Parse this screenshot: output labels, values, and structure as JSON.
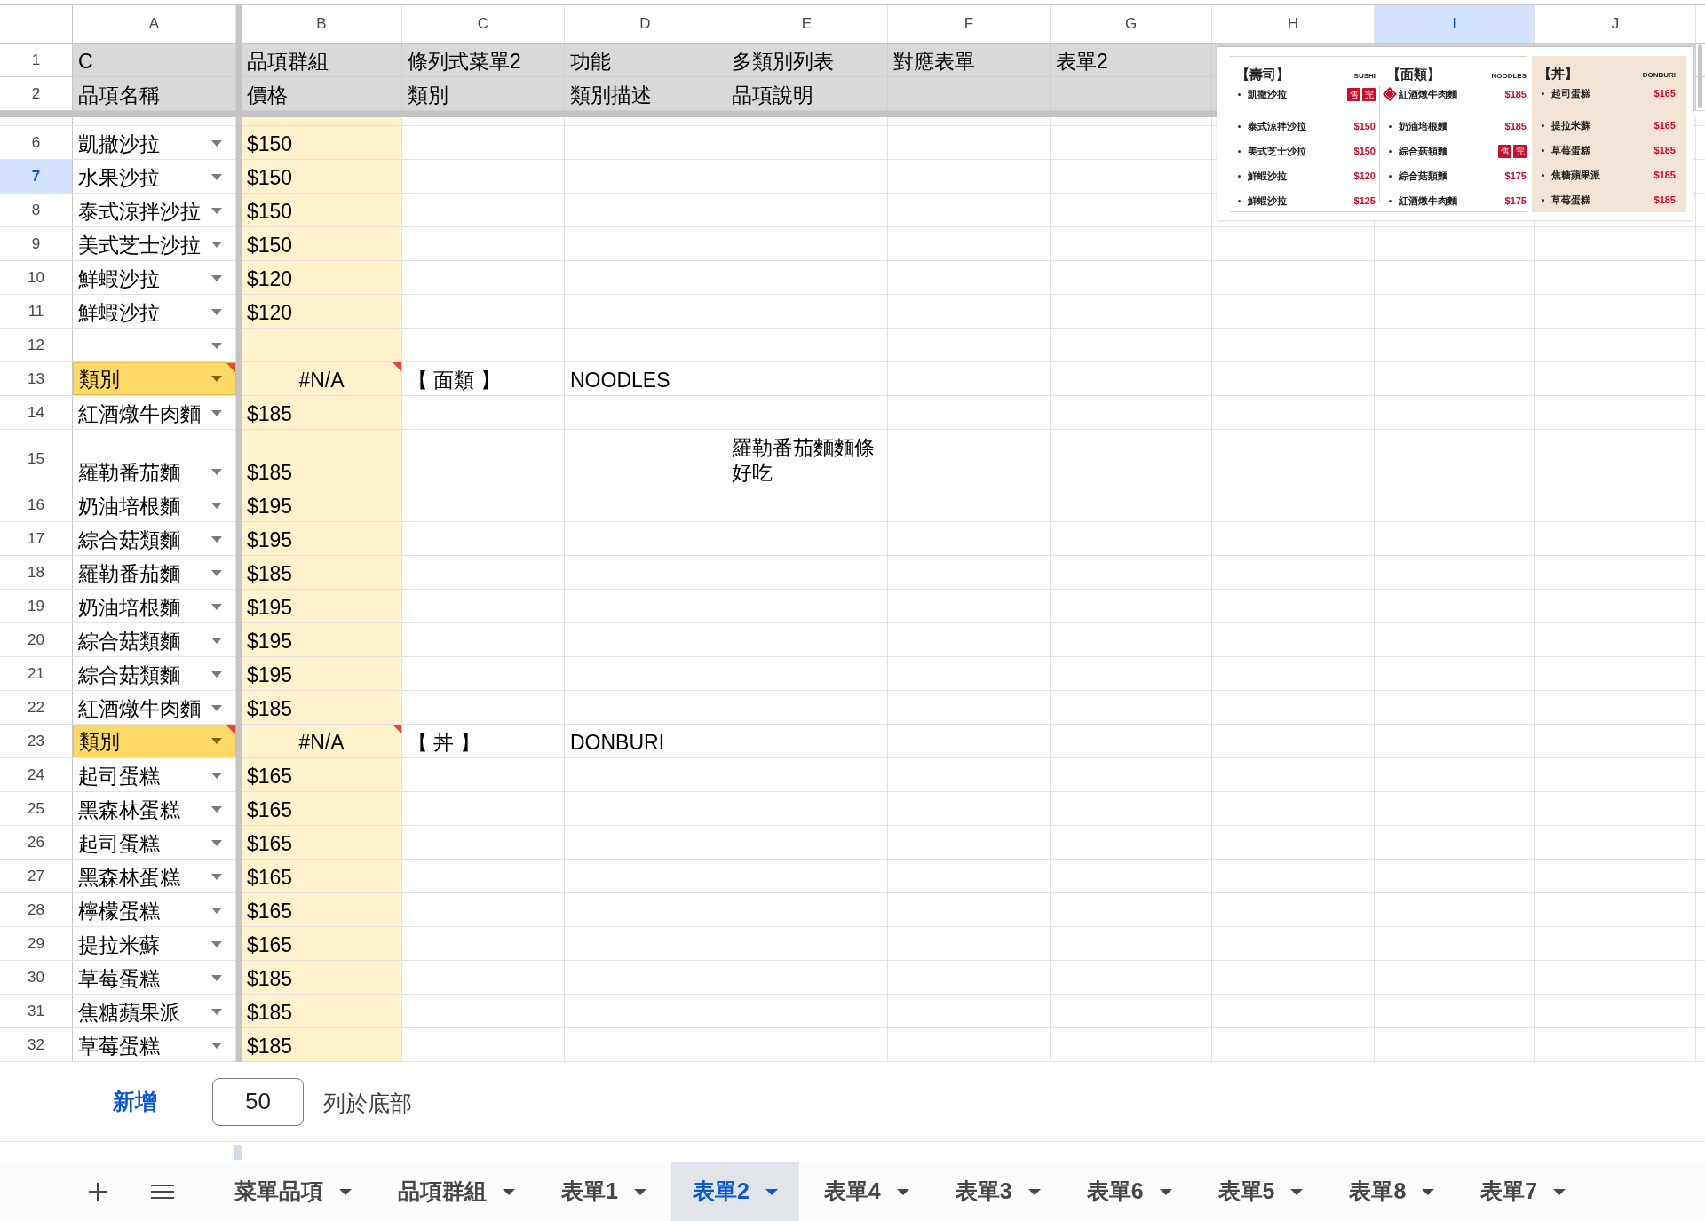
{
  "sheet": {
    "columns": [
      {
        "label": "A",
        "selected": false
      },
      {
        "label": "B",
        "selected": false
      },
      {
        "label": "C",
        "selected": false
      },
      {
        "label": "D",
        "selected": false
      },
      {
        "label": "E",
        "selected": false
      },
      {
        "label": "F",
        "selected": false
      },
      {
        "label": "G",
        "selected": false
      },
      {
        "label": "H",
        "selected": false
      },
      {
        "label": "I",
        "selected": true
      },
      {
        "label": "J",
        "selected": false
      }
    ],
    "header_rows": [
      {
        "number": "1",
        "cells": [
          "C",
          "品項群組",
          "條列式菜單2",
          "功能",
          "多類別列表",
          "對應表單",
          "表單2"
        ]
      },
      {
        "number": "2",
        "cells": [
          "品項名稱",
          "價格",
          "類別",
          "類別描述",
          "品項說明"
        ]
      }
    ],
    "rows": [
      {
        "number": "6",
        "selected": false,
        "invalid": false,
        "kind": "item",
        "name": "凱撒沙拉",
        "price": "$150"
      },
      {
        "number": "7",
        "selected": true,
        "invalid": false,
        "kind": "item",
        "name": "水果沙拉",
        "price": "$150"
      },
      {
        "number": "8",
        "selected": false,
        "invalid": false,
        "kind": "item",
        "name": "泰式涼拌沙拉",
        "price": "$150"
      },
      {
        "number": "9",
        "selected": false,
        "invalid": false,
        "kind": "item",
        "name": "美式芝士沙拉",
        "price": "$150"
      },
      {
        "number": "10",
        "selected": false,
        "invalid": false,
        "kind": "item",
        "name": "鮮蝦沙拉",
        "price": "$120"
      },
      {
        "number": "11",
        "selected": false,
        "invalid": false,
        "kind": "item",
        "name": "鮮蝦沙拉",
        "price": "$120"
      },
      {
        "number": "12",
        "selected": false,
        "invalid": false,
        "kind": "blank"
      },
      {
        "number": "13",
        "selected": false,
        "invalid": true,
        "kind": "category",
        "name": "類別",
        "value": "#N/A",
        "category": "【 面類 】",
        "category_description": "NOODLES"
      },
      {
        "number": "14",
        "selected": false,
        "invalid": false,
        "kind": "item",
        "name": "紅酒燉牛肉麵",
        "price": "$185"
      },
      {
        "number": "15",
        "selected": false,
        "invalid": false,
        "kind": "item",
        "name": "羅勒番茄麵",
        "price": "$185",
        "item_description": "羅勒番茄麵麵條好吃"
      },
      {
        "number": "16",
        "selected": false,
        "invalid": false,
        "kind": "item",
        "name": "奶油培根麵",
        "price": "$195"
      },
      {
        "number": "17",
        "selected": false,
        "invalid": false,
        "kind": "item",
        "name": "綜合菇類麵",
        "price": "$195"
      },
      {
        "number": "18",
        "selected": false,
        "invalid": false,
        "kind": "item",
        "name": "羅勒番茄麵",
        "price": "$185"
      },
      {
        "number": "19",
        "selected": false,
        "invalid": false,
        "kind": "item",
        "name": "奶油培根麵",
        "price": "$195"
      },
      {
        "number": "20",
        "selected": false,
        "invalid": false,
        "kind": "item",
        "name": "綜合菇類麵",
        "price": "$195"
      },
      {
        "number": "21",
        "selected": false,
        "invalid": false,
        "kind": "item",
        "name": "綜合菇類麵",
        "price": "$195"
      },
      {
        "number": "22",
        "selected": false,
        "invalid": false,
        "kind": "item",
        "name": "紅酒燉牛肉麵",
        "price": "$185"
      },
      {
        "number": "23",
        "selected": false,
        "invalid": true,
        "kind": "category",
        "name": "類別",
        "value": "#N/A",
        "category": "【 丼 】",
        "category_description": "DONBURI"
      },
      {
        "number": "24",
        "selected": false,
        "invalid": false,
        "kind": "item",
        "name": "起司蛋糕",
        "price": "$165"
      },
      {
        "number": "25",
        "selected": false,
        "invalid": false,
        "kind": "item",
        "name": "黑森林蛋糕",
        "price": "$165"
      },
      {
        "number": "26",
        "selected": false,
        "invalid": false,
        "kind": "item",
        "name": "起司蛋糕",
        "price": "$165"
      },
      {
        "number": "27",
        "selected": false,
        "invalid": false,
        "kind": "item",
        "name": "黑森林蛋糕",
        "price": "$165"
      },
      {
        "number": "28",
        "selected": false,
        "invalid": false,
        "kind": "item",
        "name": "檸檬蛋糕",
        "price": "$165"
      },
      {
        "number": "29",
        "selected": false,
        "invalid": false,
        "kind": "item",
        "name": "提拉米蘇",
        "price": "$165"
      },
      {
        "number": "30",
        "selected": false,
        "invalid": false,
        "kind": "item",
        "name": "草莓蛋糕",
        "price": "$185"
      },
      {
        "number": "31",
        "selected": false,
        "invalid": false,
        "kind": "item",
        "name": "焦糖蘋果派",
        "price": "$185"
      },
      {
        "number": "32",
        "selected": false,
        "invalid": false,
        "kind": "item",
        "name": "草莓蛋糕",
        "price": "$185"
      }
    ]
  },
  "menu_image": {
    "sections": [
      {
        "title": "【壽司】",
        "subtitle": "SUSHI",
        "highlighted": false,
        "items": [
          {
            "kind": "sold_out",
            "name": "凱撒沙拉",
            "tags": [
              "售",
              "完"
            ]
          },
          {
            "kind": "price",
            "name": "泰式涼拌沙拉",
            "price": "$150"
          },
          {
            "kind": "price",
            "name": "美式芝士沙拉",
            "price": "$150"
          },
          {
            "kind": "price",
            "name": "鮮蝦沙拉",
            "price": "$120"
          },
          {
            "kind": "price",
            "name": "鮮蝦沙拉",
            "price": "$125"
          }
        ]
      },
      {
        "title": "【面類】",
        "subtitle": "NOODLES",
        "highlighted": false,
        "items": [
          {
            "kind": "featured",
            "name": "紅酒燉牛肉麵",
            "price": "$185"
          },
          {
            "kind": "price",
            "name": "奶油培根麵",
            "price": "$185"
          },
          {
            "kind": "sold_out",
            "name": "綜合菇類麵",
            "tags": [
              "售",
              "完"
            ]
          },
          {
            "kind": "price",
            "name": "綜合菇類麵",
            "price": "$175"
          },
          {
            "kind": "price",
            "name": "紅酒燉牛肉麵",
            "price": "$175"
          }
        ]
      },
      {
        "title": "【丼】",
        "subtitle": "DONBURI",
        "highlighted": true,
        "items": [
          {
            "kind": "price",
            "name": "起司蛋糕",
            "price": "$165"
          },
          {
            "kind": "price",
            "name": "提拉米蘇",
            "price": "$165"
          },
          {
            "kind": "price",
            "name": "草莓蛋糕",
            "price": "$185"
          },
          {
            "kind": "price",
            "name": "焦糖蘋果派",
            "price": "$185"
          },
          {
            "kind": "price",
            "name": "草莓蛋糕",
            "price": "$185"
          }
        ]
      }
    ]
  },
  "add_rows": {
    "button": "新增",
    "count": "50",
    "label": "列於底部"
  },
  "sheet_tabs": [
    {
      "label": "菜單品項",
      "selected": false
    },
    {
      "label": "品項群組",
      "selected": false
    },
    {
      "label": "表單1",
      "selected": false
    },
    {
      "label": "表單2",
      "selected": true
    },
    {
      "label": "表單4",
      "selected": false
    },
    {
      "label": "表單3",
      "selected": false
    },
    {
      "label": "表單6",
      "selected": false
    },
    {
      "label": "表單5",
      "selected": false
    },
    {
      "label": "表單8",
      "selected": false
    },
    {
      "label": "表單7",
      "selected": false
    }
  ]
}
